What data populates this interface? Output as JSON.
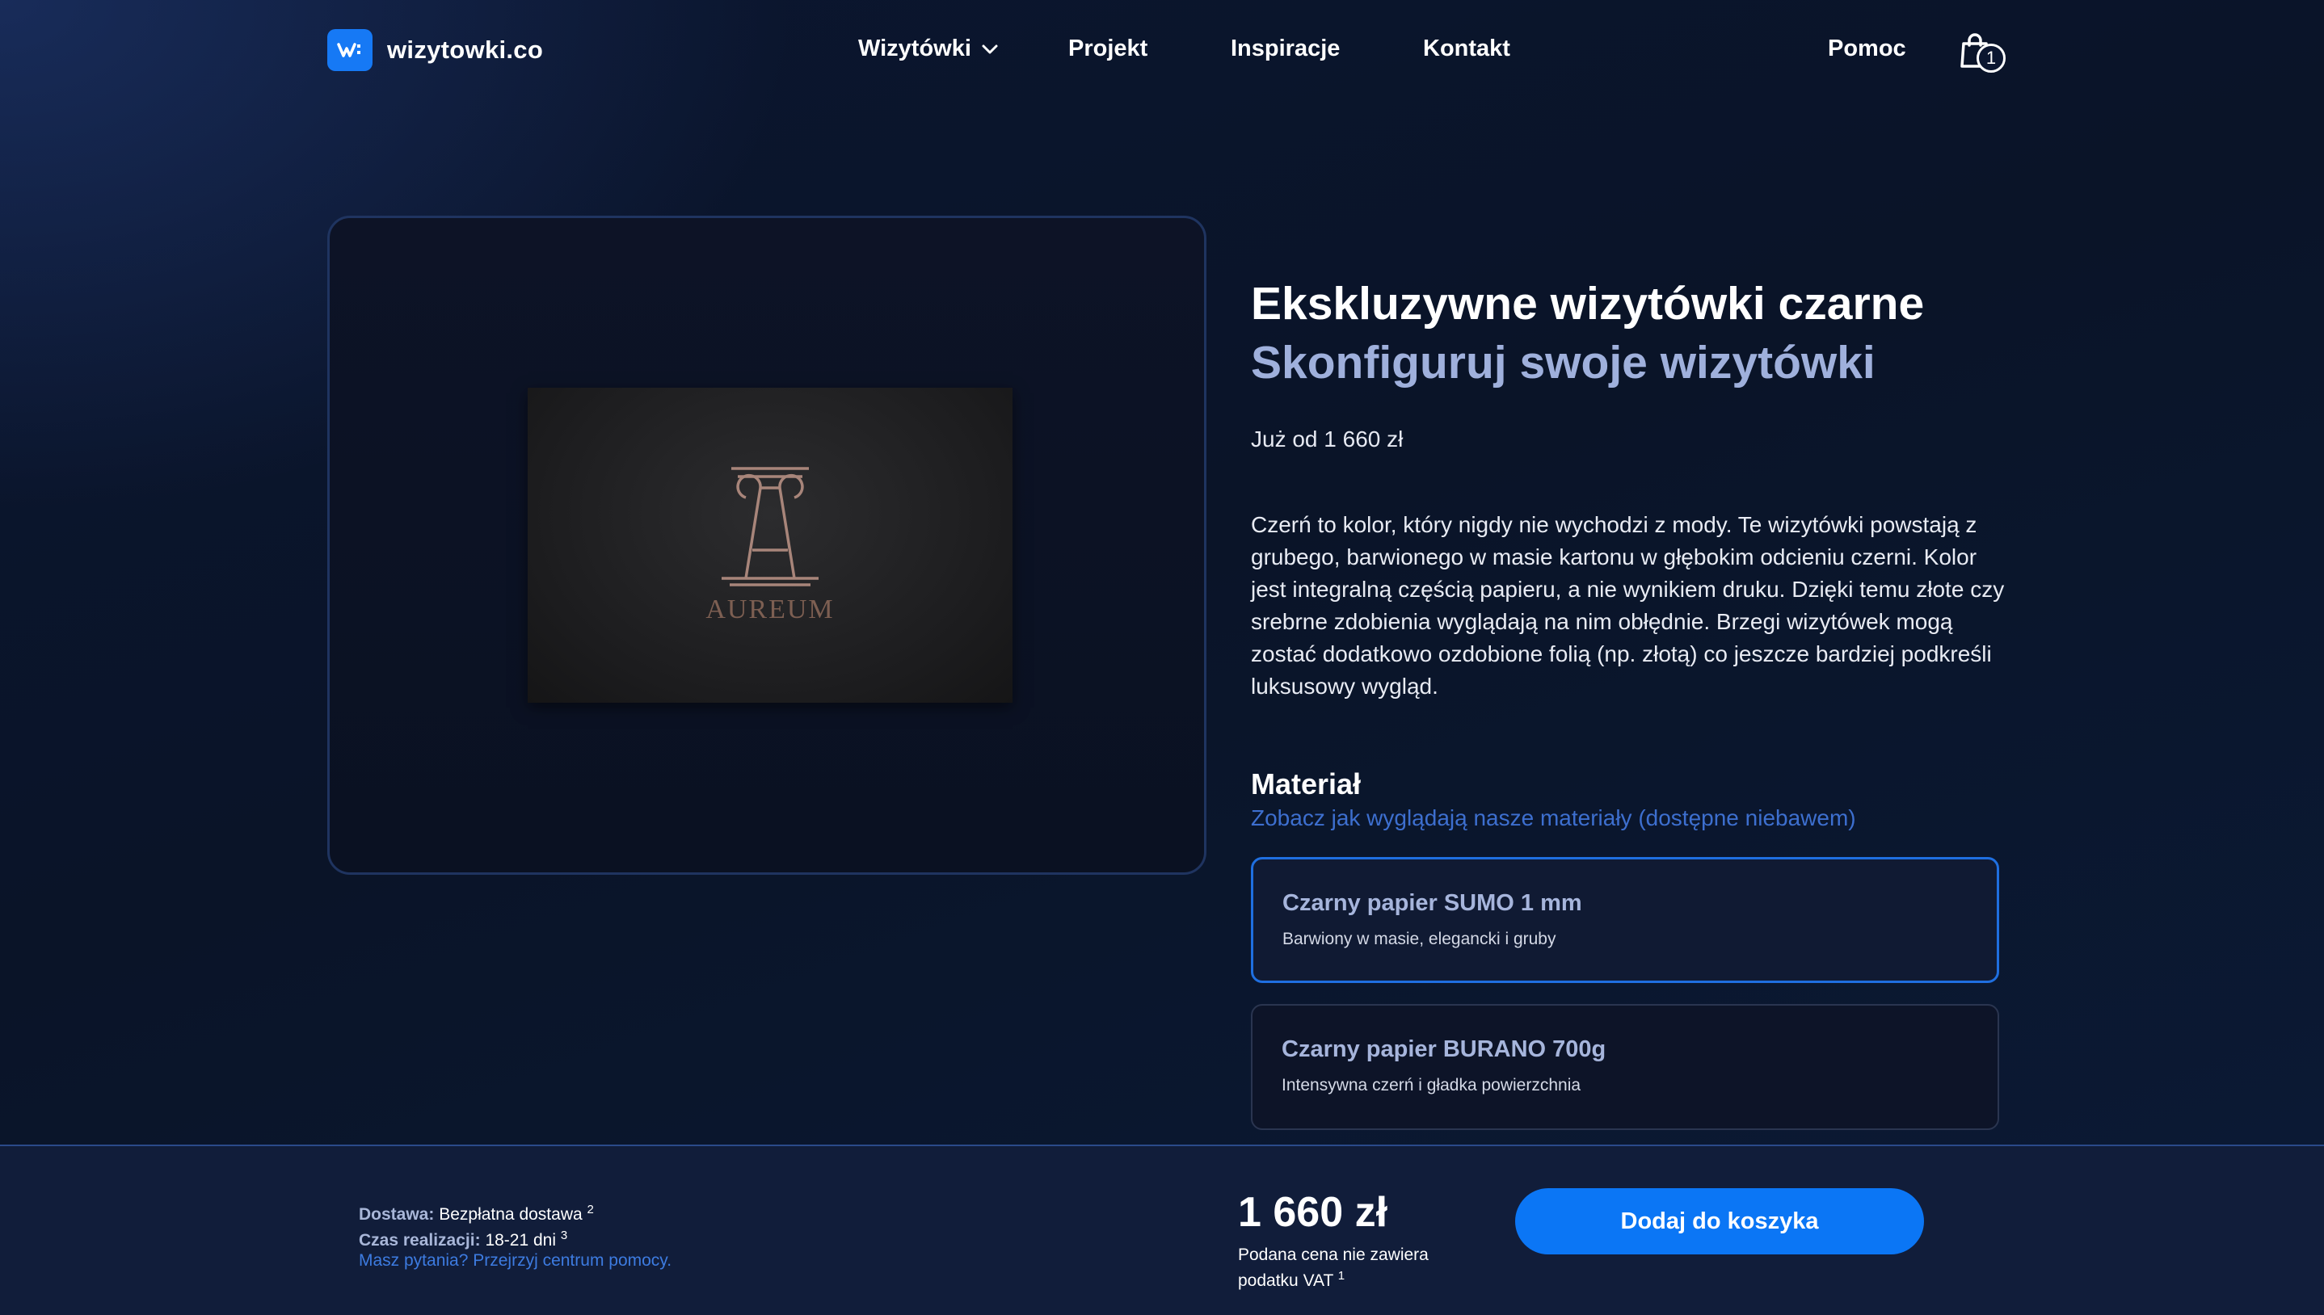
{
  "nav": {
    "logo_text": "wizytowki.co",
    "items": [
      {
        "label": "Wizytówki"
      },
      {
        "label": "Projekt"
      },
      {
        "label": "Inspiracje"
      },
      {
        "label": "Kontakt"
      }
    ],
    "help": "Pomoc",
    "cart_count": "1",
    "icons": [
      "logo-mark",
      "chevron-down-icon",
      "shopping-bag-icon"
    ]
  },
  "product": {
    "card_brand": "AUREUM",
    "title": "Ekskluzywne wizytówki czarne",
    "subtitle": "Skonfiguruj swoje wizytówki",
    "price_from": "Już od 1 660 zł",
    "description": "Czerń to kolor, który nigdy nie wychodzi z mody. Te wizytówki powstają z grubego, barwionego w masie kartonu w głębokim odcieniu czerni. Kolor jest integralną częścią papieru, a nie wynikiem druku. Dzięki temu złote czy srebrne zdobienia wyglądają na nim obłędnie. Brzegi wizytówek mogą zostać dodatkowo ozdobione folią (np. złotą) co jeszcze bardziej podkreśli luksusowy wygląd."
  },
  "material": {
    "heading": "Materiał",
    "link": "Zobacz jak wyglądają nasze materiały (dostępne niebawem)",
    "options": [
      {
        "title": "Czarny papier SUMO 1 mm",
        "subtitle": "Barwiony w masie, elegancki i gruby",
        "selected": true
      },
      {
        "title": "Czarny papier BURANO 700g",
        "subtitle": "Intensywna czerń i gładka powierzchnia",
        "selected": false
      }
    ]
  },
  "bottom_bar": {
    "delivery_label": "Dostawa:",
    "delivery_value": "Bezpłatna dostawa",
    "delivery_note": "2",
    "time_label": "Czas realizacji:",
    "time_value": "18-21 dni",
    "time_note": "3",
    "help_link": "Masz pytania? Przejrzyj centrum pomocy.",
    "price": "1 660 zł",
    "vat_note": "Podana cena nie zawiera podatku VAT",
    "vat_note_ref": "1",
    "cta": "Dodaj do koszyka"
  },
  "colors": {
    "accent": "#0b76f5",
    "subtitle": "#9fb0dc",
    "link": "#3d6fcf",
    "card_brand": "#7d5f52"
  }
}
